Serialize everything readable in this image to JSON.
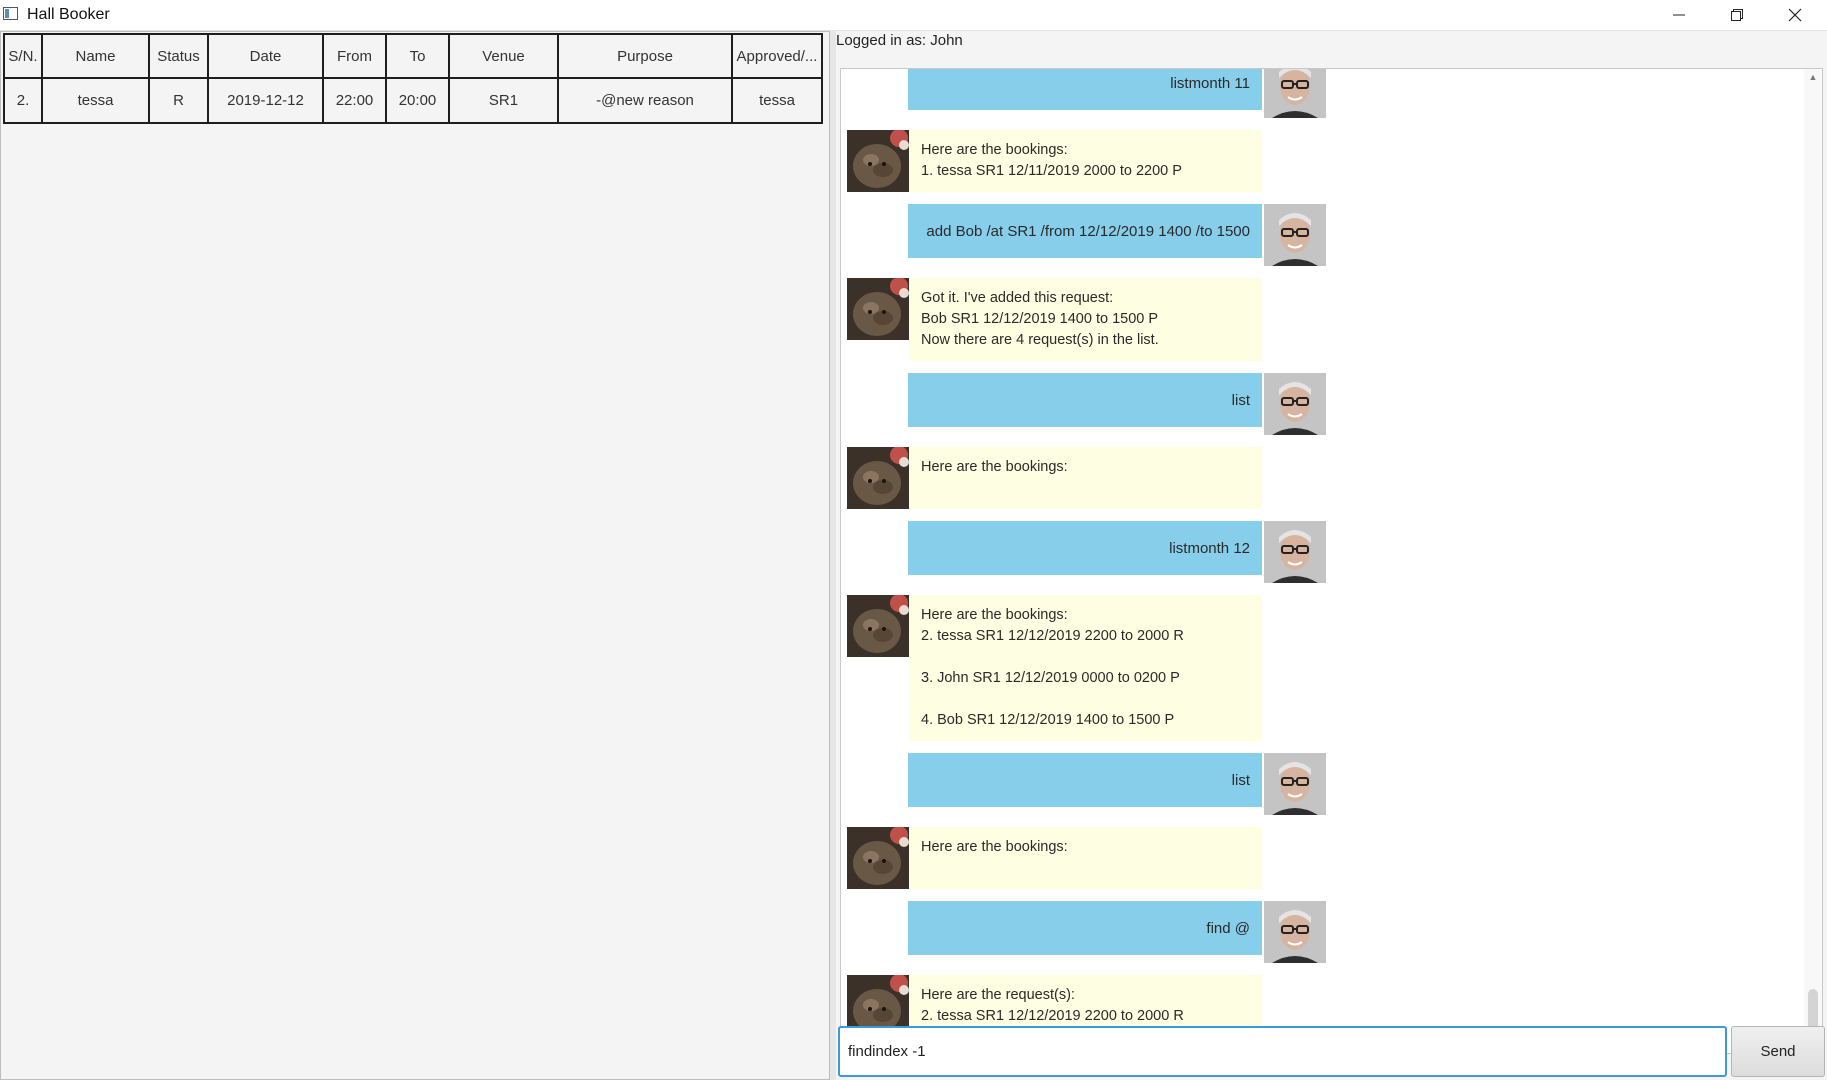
{
  "window": {
    "title": "Hall Booker"
  },
  "table": {
    "headers": [
      "S/N.",
      "Name",
      "Status",
      "Date",
      "From",
      "To",
      "Venue",
      "Purpose",
      "Approved/..."
    ],
    "rows": [
      [
        "2.",
        "tessa",
        "R",
        "2019-12-12",
        "22:00",
        "20:00",
        "SR1",
        "-@new reason",
        "tessa"
      ]
    ]
  },
  "status": {
    "logged_in": "Logged in as: John"
  },
  "chat": [
    {
      "from": "user",
      "text": "listmonth 11"
    },
    {
      "from": "bot",
      "text": "Here are the bookings:\n1. tessa SR1 12/11/2019 2000 to 2200 P"
    },
    {
      "from": "user",
      "text": "add Bob /at SR1 /from 12/12/2019 1400 /to 1500"
    },
    {
      "from": "bot",
      "text": "Got it. I've added this request:\nBob SR1 12/12/2019 1400 to 1500 P\nNow there are 4 request(s) in the list."
    },
    {
      "from": "user",
      "text": "list"
    },
    {
      "from": "bot",
      "text": "Here are the bookings:"
    },
    {
      "from": "user",
      "text": "listmonth 12"
    },
    {
      "from": "bot",
      "text": "Here are the bookings:\n2. tessa SR1 12/12/2019 2200 to 2000 R\n\n3. John SR1 12/12/2019 0000 to 0200 P\n\n4. Bob SR1 12/12/2019 1400 to 1500 P"
    },
    {
      "from": "user",
      "text": "list"
    },
    {
      "from": "bot",
      "text": "Here are the bookings:"
    },
    {
      "from": "user",
      "text": "find @"
    },
    {
      "from": "bot",
      "text": "Here are the request(s):\n2. tessa SR1 12/12/2019 2200 to 2000 R"
    }
  ],
  "input": {
    "value": "findindex -1"
  },
  "send_label": "Send",
  "colors": {
    "user_bubble": "#87ceeb",
    "bot_bubble": "#fefee2",
    "input_focus": "#3c9ad6"
  }
}
